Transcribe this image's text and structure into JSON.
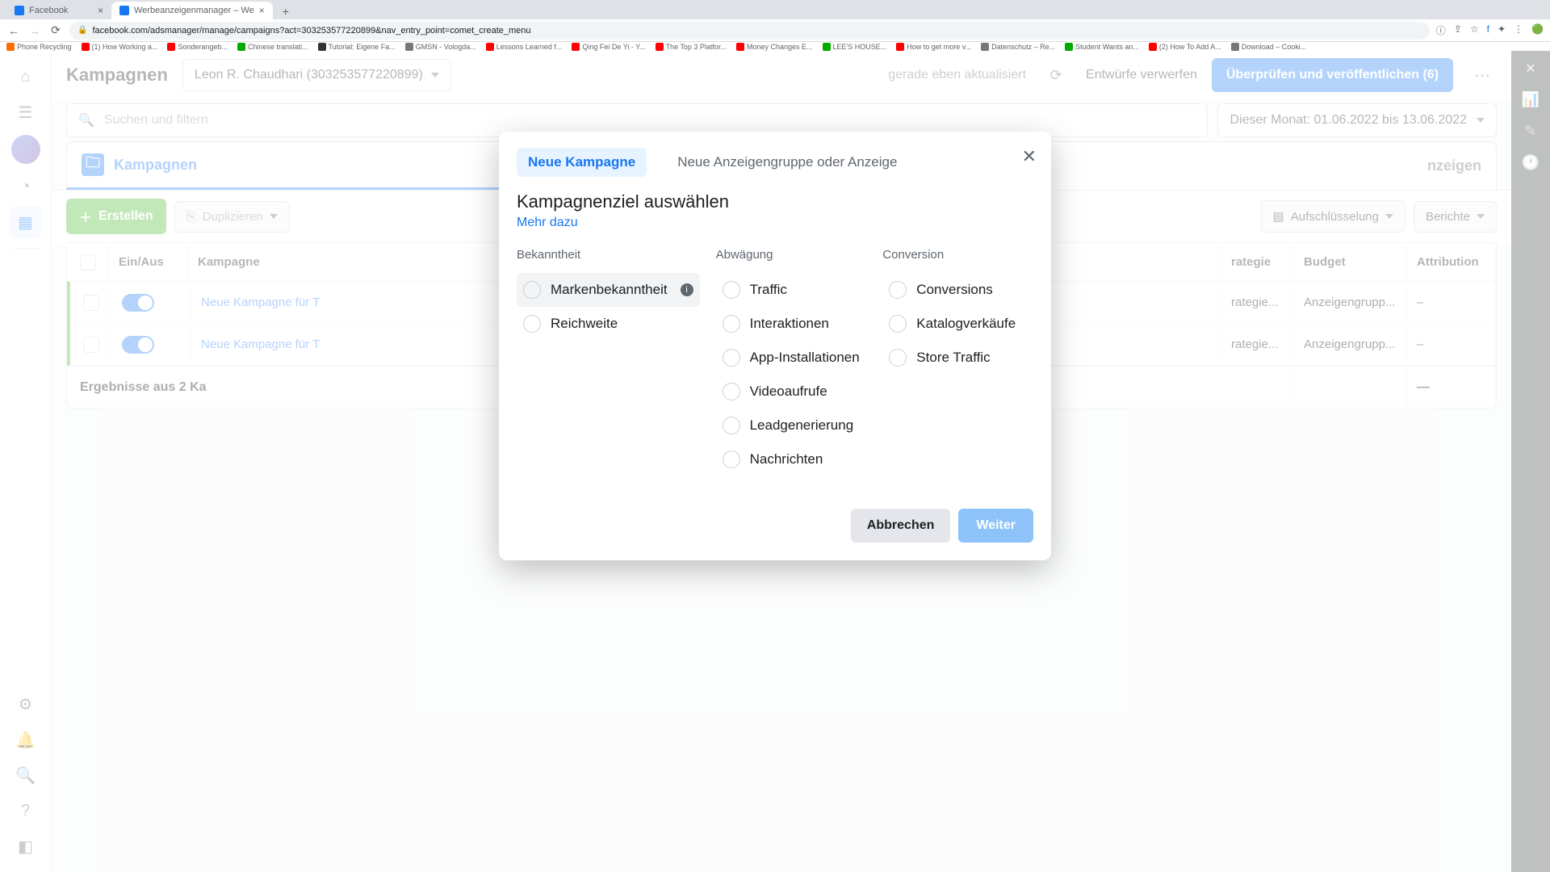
{
  "browser": {
    "tabs": [
      {
        "title": "Facebook"
      },
      {
        "title": "Werbeanzeigenmanager – We"
      }
    ],
    "url": "facebook.com/adsmanager/manage/campaigns?act=303253577220899&nav_entry_point=comet_create_menu",
    "bookmarks": [
      "Phone Recycling",
      "(1) How Working a...",
      "Sonderangeb...",
      "Chinese translati...",
      "Tutorial: Eigene Fa...",
      "GMSN - Vologda...",
      "Lessons Learned f...",
      "Qing Fei De Yi - Y...",
      "The Top 3 Platfor...",
      "Money Changes E...",
      "LEE'S HOUSE...",
      "How to get more v...",
      "Datenschutz – Re...",
      "Student Wants an...",
      "(2) How To Add A...",
      "Download – Cooki..."
    ]
  },
  "header": {
    "pageTitle": "Kampagnen",
    "accountName": "Leon R. Chaudhari (303253577220899)",
    "status": "gerade eben aktualisiert",
    "discard": "Entwürfe verwerfen",
    "publish": "Überprüfen und veröffentlichen (6)"
  },
  "search": {
    "placeholder": "Suchen und filtern",
    "dateRange": "Dieser Monat: 01.06.2022 bis 13.06.2022"
  },
  "tabs": {
    "campaigns": "Kampagnen",
    "ads": "nzeigen"
  },
  "toolbar": {
    "create": "Erstellen",
    "duplicate": "Duplizieren",
    "breakdown": "Aufschlüsselung",
    "reports": "Berichte"
  },
  "table": {
    "headers": {
      "toggle": "Ein/Aus",
      "campaign": "Kampagne",
      "strategy": "rategie",
      "budget": "Budget",
      "attribution": "Attribution"
    },
    "rows": [
      {
        "name": "Neue Kampagne für T",
        "strategy": "rategie...",
        "budget": "Anzeigengrupp...",
        "attribution": "–"
      },
      {
        "name": "Neue Kampagne für T",
        "strategy": "rategie...",
        "budget": "Anzeigengrupp...",
        "attribution": "–"
      }
    ],
    "summary": "Ergebnisse aus 2 Ka",
    "summaryAttr": "—"
  },
  "modal": {
    "tabNew": "Neue Kampagne",
    "tabExisting": "Neue Anzeigengruppe oder Anzeige",
    "title": "Kampagnenziel auswählen",
    "moreLink": "Mehr dazu",
    "columns": {
      "awareness": {
        "title": "Bekanntheit",
        "options": [
          "Markenbekanntheit",
          "Reichweite"
        ]
      },
      "consideration": {
        "title": "Abwägung",
        "options": [
          "Traffic",
          "Interaktionen",
          "App-Installationen",
          "Videoaufrufe",
          "Leadgenerierung",
          "Nachrichten"
        ]
      },
      "conversion": {
        "title": "Conversion",
        "options": [
          "Conversions",
          "Katalogverkäufe",
          "Store Traffic"
        ]
      }
    },
    "cancel": "Abbrechen",
    "next": "Weiter"
  }
}
